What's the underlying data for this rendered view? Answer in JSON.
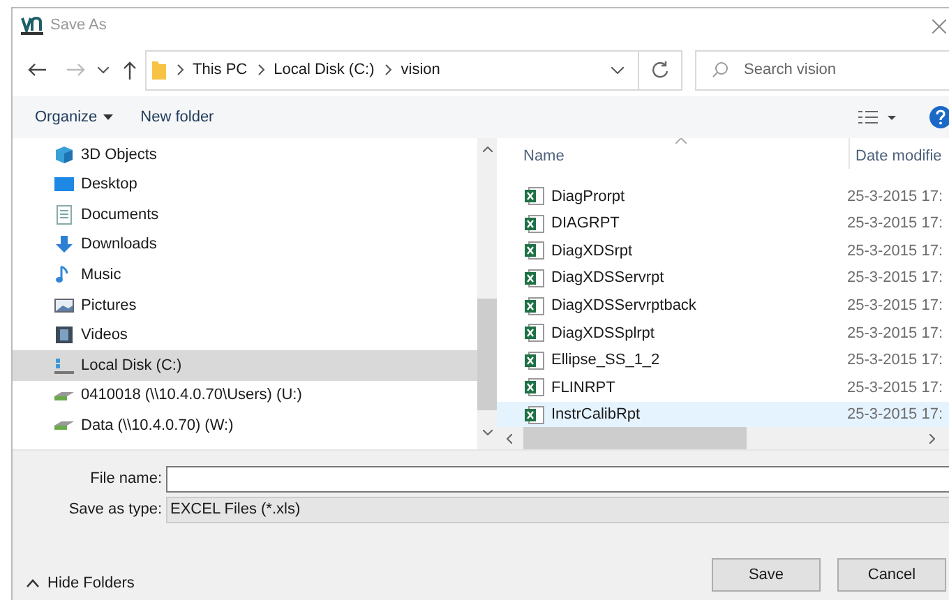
{
  "window": {
    "title": "Save As"
  },
  "address": {
    "crumbs": [
      "This PC",
      "Local Disk (C:)",
      "vision"
    ]
  },
  "search": {
    "placeholder": "Search vision"
  },
  "toolbar": {
    "organize": "Organize",
    "new_folder": "New folder"
  },
  "nav": {
    "items": [
      {
        "label": "3D Objects",
        "kind": "objects3d",
        "selected": false
      },
      {
        "label": "Desktop",
        "kind": "desktop",
        "selected": false
      },
      {
        "label": "Documents",
        "kind": "documents",
        "selected": false
      },
      {
        "label": "Downloads",
        "kind": "downloads",
        "selected": false
      },
      {
        "label": "Music",
        "kind": "music",
        "selected": false
      },
      {
        "label": "Pictures",
        "kind": "pictures",
        "selected": false
      },
      {
        "label": "Videos",
        "kind": "videos",
        "selected": false
      },
      {
        "label": "Local Disk (C:)",
        "kind": "disk",
        "selected": true
      },
      {
        "label": "0410018 (\\\\10.4.0.70\\Users) (U:)",
        "kind": "netdrive",
        "selected": false
      },
      {
        "label": "Data (\\\\10.4.0.70) (W:)",
        "kind": "netdrive",
        "selected": false
      }
    ]
  },
  "table": {
    "columns": [
      "Name",
      "Date modifie"
    ],
    "rows": [
      {
        "name": "DiagProrpt",
        "date": "25-3-2015 17:",
        "selected": false
      },
      {
        "name": "DIAGRPT",
        "date": "25-3-2015 17:",
        "selected": false
      },
      {
        "name": "DiagXDSrpt",
        "date": "25-3-2015 17:",
        "selected": false
      },
      {
        "name": "DiagXDSServrpt",
        "date": "25-3-2015 17:",
        "selected": false
      },
      {
        "name": "DiagXDSServrptback",
        "date": "25-3-2015 17:",
        "selected": false
      },
      {
        "name": "DiagXDSSplrpt",
        "date": "25-3-2015 17:",
        "selected": false
      },
      {
        "name": "Ellipse_SS_1_2",
        "date": "25-3-2015 17:",
        "selected": false
      },
      {
        "name": "FLINRPT",
        "date": "25-3-2015 17:",
        "selected": false
      },
      {
        "name": "InstrCalibRpt",
        "date": "25-3-2015 17:",
        "selected": true
      }
    ]
  },
  "form": {
    "file_name_label": "File name:",
    "save_type_label": "Save as type:",
    "save_type": "EXCEL Files (*.xls)"
  },
  "footer": {
    "hide_folders": "Hide Folders",
    "buttons": [
      "Save",
      "Cancel"
    ]
  }
}
